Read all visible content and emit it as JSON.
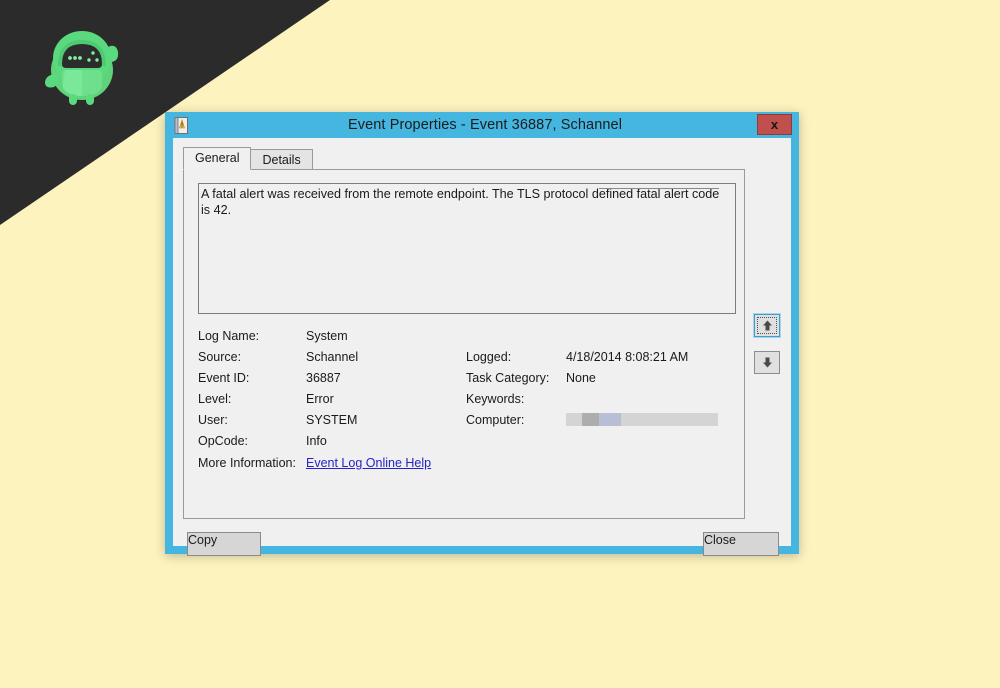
{
  "background": {
    "page_color": "#fdf3bf",
    "banner_color": "#2b2b2b",
    "logo_name": "green-robot-mascot"
  },
  "dialog": {
    "title": "Event Properties - Event 36887, Schannel",
    "icon_name": "event-log-icon",
    "frame_color": "#45b6e0",
    "close_button_label": "x",
    "close_button_color": "#c0504d"
  },
  "tabs": [
    {
      "label": "General",
      "active": true
    },
    {
      "label": "Details",
      "active": false
    }
  ],
  "message": {
    "text": "A fatal alert was received from the remote endpoint. The TLS protocol defined fatal alert code is 42."
  },
  "fields": {
    "left": [
      {
        "label": "Log Name:",
        "value": "System"
      },
      {
        "label": "Source:",
        "value": "Schannel"
      },
      {
        "label": "Event ID:",
        "value": "36887"
      },
      {
        "label": "Level:",
        "value": "Error"
      },
      {
        "label": "User:",
        "value": "SYSTEM"
      },
      {
        "label": "OpCode:",
        "value": "Info"
      }
    ],
    "right": [
      {
        "label": "",
        "value": ""
      },
      {
        "label": "Logged:",
        "value": "4/18/2014 8:08:21 AM"
      },
      {
        "label": "Task Category:",
        "value": "None"
      },
      {
        "label": "Keywords:",
        "value": ""
      },
      {
        "label": "Computer:",
        "value": "",
        "redacted": true
      },
      {
        "label": "",
        "value": ""
      }
    ],
    "more_information_label": "More Information:",
    "help_link_label": "Event Log Online Help",
    "help_link_color": "#2424c8"
  },
  "nav": {
    "up_label": "previous-event",
    "down_label": "next-event"
  },
  "buttons": {
    "copy_label": "Copy",
    "close_label": "Close"
  }
}
